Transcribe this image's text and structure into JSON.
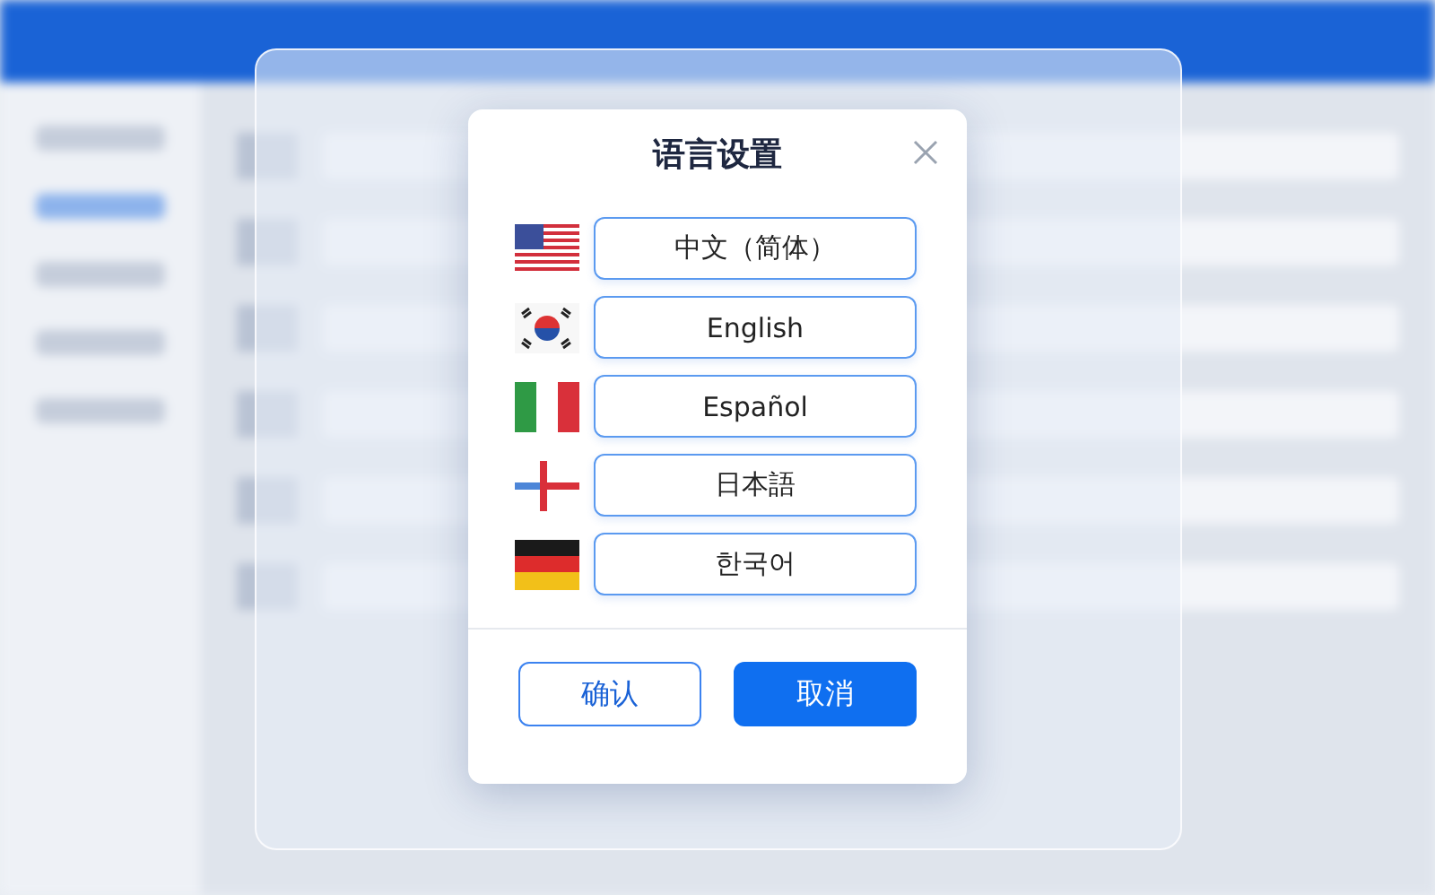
{
  "dialog": {
    "title": "语言设置",
    "languages": [
      {
        "label": "中文（简体）"
      },
      {
        "label": "English"
      },
      {
        "label": "Español"
      },
      {
        "label": "日本語"
      },
      {
        "label": "한국어"
      }
    ],
    "buttons": [
      {
        "label": "确认",
        "kind": "secondary"
      },
      {
        "label": "取消",
        "kind": "primary"
      }
    ]
  }
}
